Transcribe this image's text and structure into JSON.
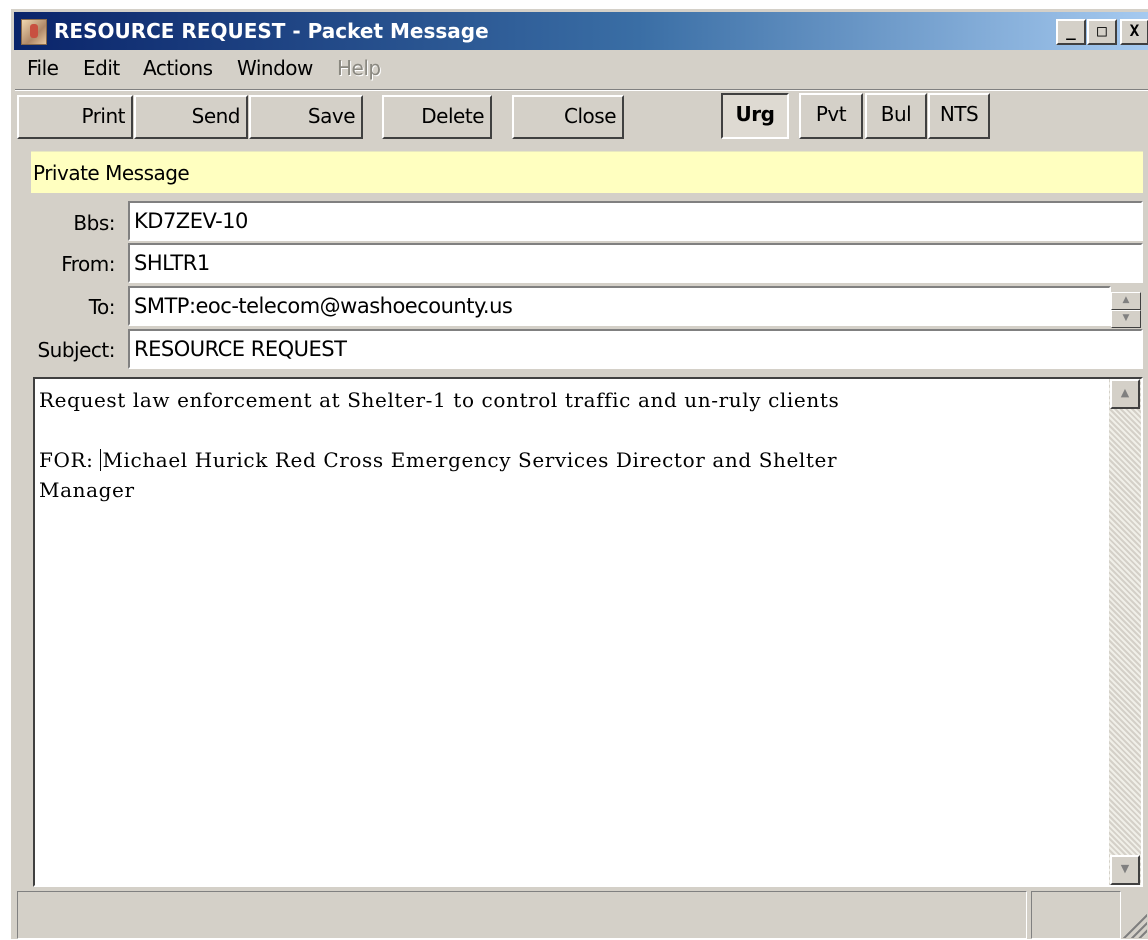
{
  "window": {
    "title": "RESOURCE REQUEST - Packet Message",
    "controls": {
      "minimize": "_",
      "maximize": "□",
      "close": "X"
    }
  },
  "menu": {
    "file": "File",
    "edit": "Edit",
    "actions": "Actions",
    "window": "Window",
    "help": "Help"
  },
  "toolbar": {
    "print": "Print",
    "send": "Send",
    "save": "Save",
    "delete": "Delete",
    "close": "Close",
    "urgent": "Urg",
    "private": "Pvt",
    "bulletin": "Bul",
    "nts": "NTS"
  },
  "banner": "Private Message",
  "fields": {
    "bbs_label": "Bbs:",
    "bbs_value": "KD7ZEV-10",
    "from_label": "From:",
    "from_value": "SHLTR1",
    "to_label": "To:",
    "to_value": "SMTP:eoc-telecom@washoecounty.us",
    "subject_label": "Subject:",
    "subject_value": "RESOURCE REQUEST"
  },
  "message": {
    "line1": "Request law enforcement at Shelter-1 to control traffic and un-ruly clients",
    "line2_prefix": "FOR: ",
    "line2_rest": "Michael Hurick Red Cross Emergency Services Director and Shelter\nManager"
  },
  "status": {
    "pane1": "",
    "pane2": ""
  }
}
